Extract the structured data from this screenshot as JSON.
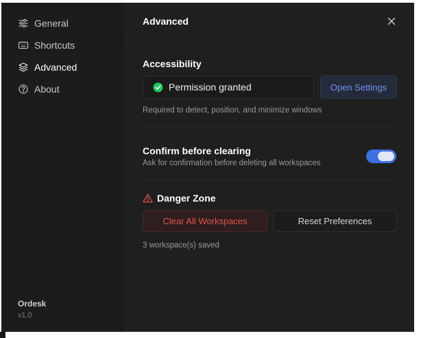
{
  "sidebar": {
    "items": [
      {
        "label": "General",
        "icon": "sliders-icon",
        "active": false
      },
      {
        "label": "Shortcuts",
        "icon": "keyboard-icon",
        "active": false
      },
      {
        "label": "Advanced",
        "icon": "layers-icon",
        "active": true
      },
      {
        "label": "About",
        "icon": "help-circle-icon",
        "active": false
      }
    ],
    "app_name": "Ordesk",
    "version": "v1.0"
  },
  "header": {
    "title": "Advanced"
  },
  "accessibility": {
    "title": "Accessibility",
    "status": "Permission granted",
    "button": "Open Settings",
    "hint": "Required to detect, position, and minimize windows"
  },
  "confirm": {
    "title": "Confirm before clearing",
    "description": "Ask for confirmation before deleting all workspaces",
    "enabled": true
  },
  "danger": {
    "title": "Danger Zone",
    "clear_button": "Clear All Workspaces",
    "reset_button": "Reset Preferences",
    "saved_count": "3 workspace(s) saved"
  },
  "colors": {
    "accent": "#3f6fe0",
    "danger": "#e0554f",
    "success": "#22c55e",
    "background": "#1f1f1f"
  }
}
